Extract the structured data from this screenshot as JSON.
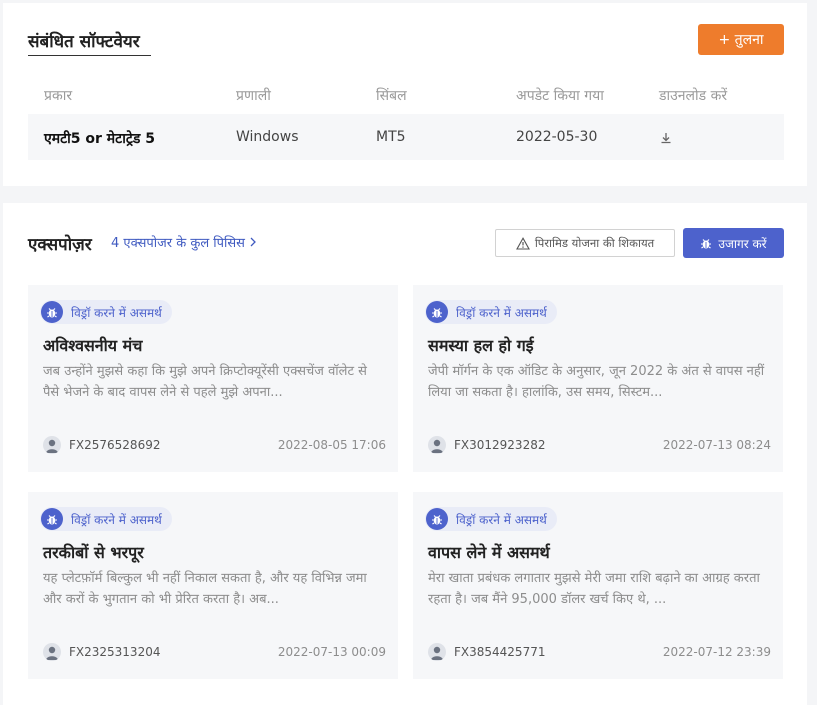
{
  "software": {
    "title": "संबंधित सॉफ्टवेयर",
    "compare_label": "+ तुलना",
    "headers": [
      "प्रकार",
      "प्रणाली",
      "सिंबल",
      "अपडेट किया गया",
      "डाउनलोड करें"
    ],
    "row": {
      "type": "एमटी5 or मेटाट्रेड 5",
      "system": "Windows",
      "symbol": "MT5",
      "updated": "2022-05-30",
      "download_icon": "download-icon"
    }
  },
  "exposure": {
    "title": "एक्सपोज़र",
    "link_label": "4 एक्सपोजर के कुल पिसिस",
    "report_label": "पिरामिड योजना की शिकायत",
    "expose_label": "उजागर करें",
    "accent_color": "#4d62cc",
    "cards": [
      {
        "badge": "विड्रॉ करने में असमर्थ",
        "title": "अविश्वसनीय मंच",
        "desc": "जब उन्होंने मुझसे कहा कि मुझे अपने क्रिप्टोक्यूरेंसी एक्सचेंज वॉलेट से पैसे भेजने के बाद वापस लेने से पहले मुझे अपना...",
        "user": "FX2576528692",
        "date": "2022-08-05 17:06"
      },
      {
        "badge": "विड्रॉ करने में असमर्थ",
        "title": "समस्या हल हो गई",
        "desc": "जेपी मॉर्गन के एक ऑडिट के अनुसार, जून 2022 के अंत से वापस नहीं लिया जा सकता है। हालांकि, उस समय, सिस्टम...",
        "user": "FX3012923282",
        "date": "2022-07-13 08:24"
      },
      {
        "badge": "विड्रॉ करने में असमर्थ",
        "title": "तरकीबों से भरपूर",
        "desc": "यह प्लेटफ़ॉर्म बिल्कुल भी नहीं निकाल सकता है, और यह विभिन्न जमा और करों के भुगतान को भी प्रेरित करता है। अब...",
        "user": "FX2325313204",
        "date": "2022-07-13 00:09"
      },
      {
        "badge": "विड्रॉ करने में असमर्थ",
        "title": "वापस लेने में असमर्थ",
        "desc": "मेरा खाता प्रबंधक लगातार मुझसे मेरी जमा राशि बढ़ाने का आग्रह करता रहता है। जब मैंने 95,000 डॉलर खर्च किए थे, ...",
        "user": "FX3854425771",
        "date": "2022-07-12 23:39"
      }
    ]
  }
}
